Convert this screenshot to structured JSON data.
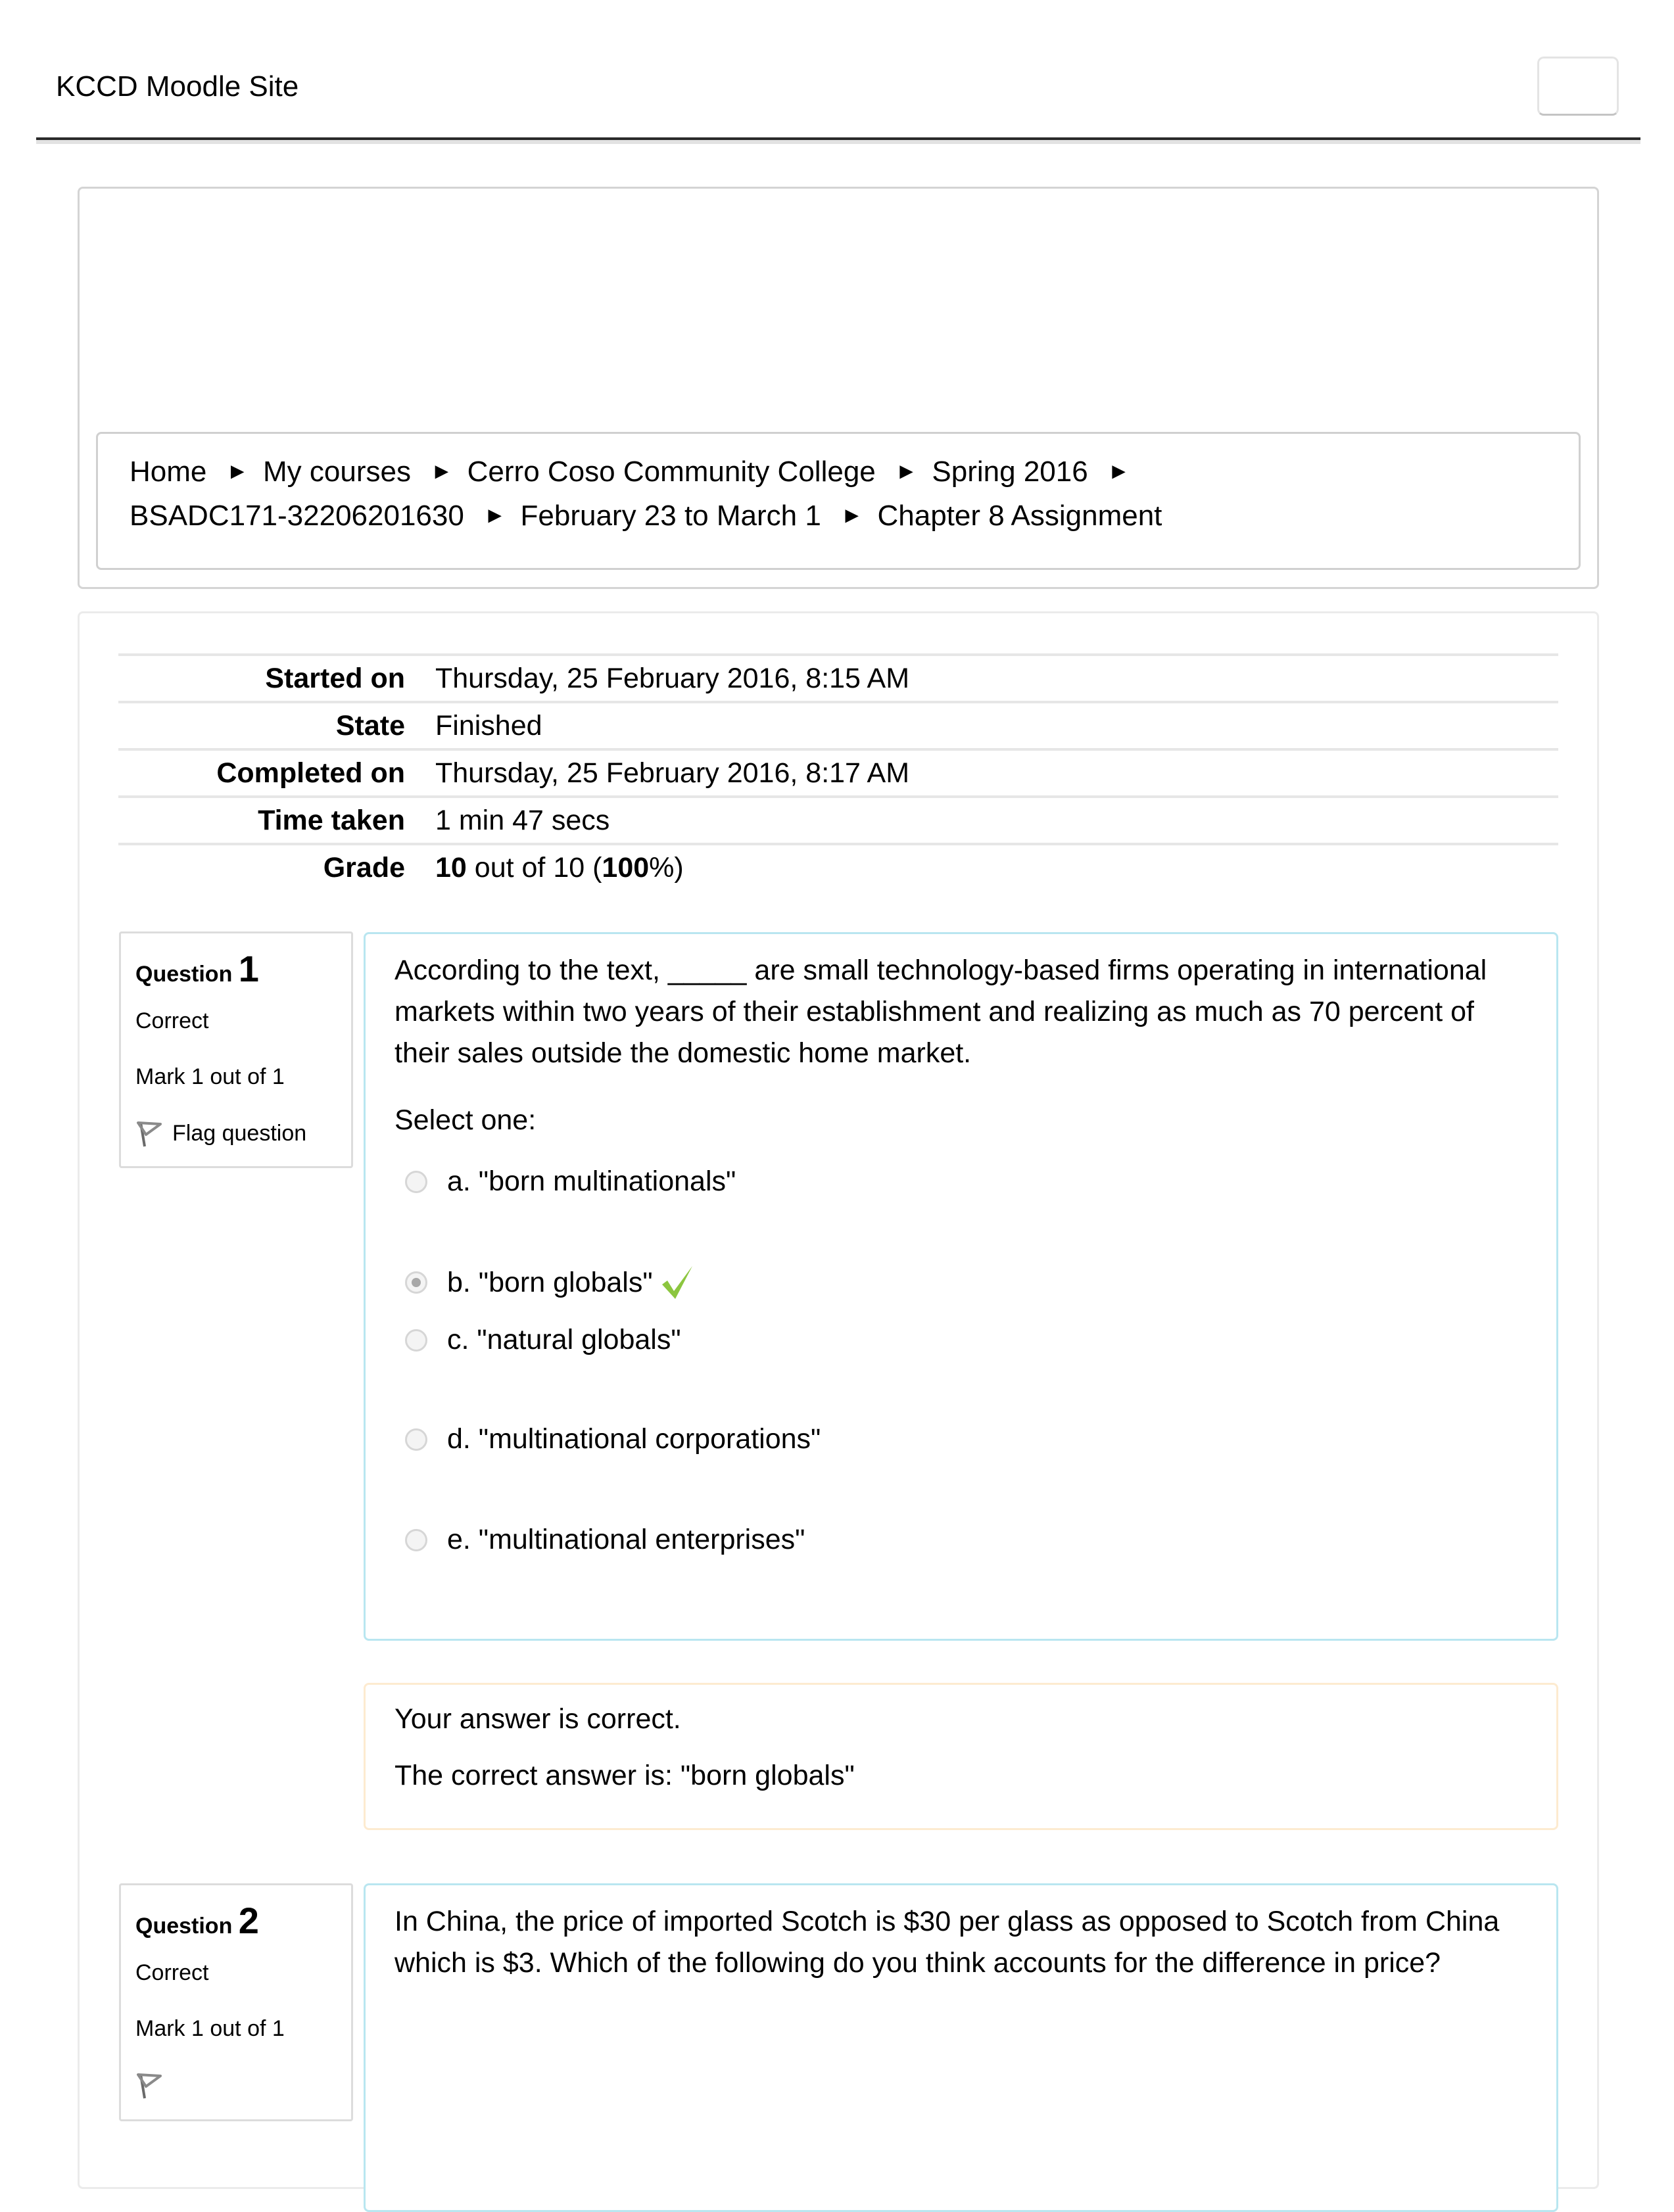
{
  "header": {
    "site_title": "KCCD Moodle Site"
  },
  "breadcrumb": {
    "separator": "►",
    "items": [
      "Home",
      "My courses",
      "Cerro Coso Community College",
      "Spring 2016",
      "BSADC171-32206201630",
      "February 23 to March 1",
      "Chapter 8 Assignment"
    ]
  },
  "summary": {
    "rows": [
      {
        "label": "Started on",
        "value": "Thursday, 25 February 2016, 8:15 AM"
      },
      {
        "label": "State",
        "value": "Finished"
      },
      {
        "label": "Completed on",
        "value": "Thursday, 25 February 2016, 8:17 AM"
      },
      {
        "label": "Time taken",
        "value": "1 min 47 secs"
      },
      {
        "label": "Grade",
        "value_parts": {
          "score": "10",
          "middle": " out of 10 (",
          "percent": "100",
          "end": "%)"
        }
      }
    ]
  },
  "questions": [
    {
      "label": "Question",
      "number": "1",
      "state": "Correct",
      "mark": "Mark 1 out of 1",
      "flag_label": "Flag question",
      "text": "According to the text, _____ are small technology-based firms operating in international markets within two years of their establishment and realizing as much as 70 percent of their sales outside the domestic home market.",
      "prompt": "Select one:",
      "options": [
        {
          "label": "a. \"born multinationals\"",
          "selected": false,
          "correct": false
        },
        {
          "label": "b. \"born globals\"",
          "selected": true,
          "correct": true
        },
        {
          "label": "c. \"natural globals\"",
          "selected": false,
          "correct": false
        },
        {
          "label": "d. \"multinational corporations\"",
          "selected": false,
          "correct": false
        },
        {
          "label": "e. \"multinational enterprises\"",
          "selected": false,
          "correct": false
        }
      ],
      "feedback": {
        "result": "Your answer is correct.",
        "correct_answer": "The correct answer is: \"born globals\""
      }
    },
    {
      "label": "Question",
      "number": "2",
      "state": "Correct",
      "mark": "Mark 1 out of 1",
      "text": "In China, the price of imported Scotch is $30 per glass as opposed to Scotch from China which is $3. Which of the following do you think accounts for the difference in price?"
    }
  ],
  "colors": {
    "correct_check": "#8cc63f",
    "question_border": "#b9e6f0",
    "feedback_border": "#fdebd0"
  }
}
